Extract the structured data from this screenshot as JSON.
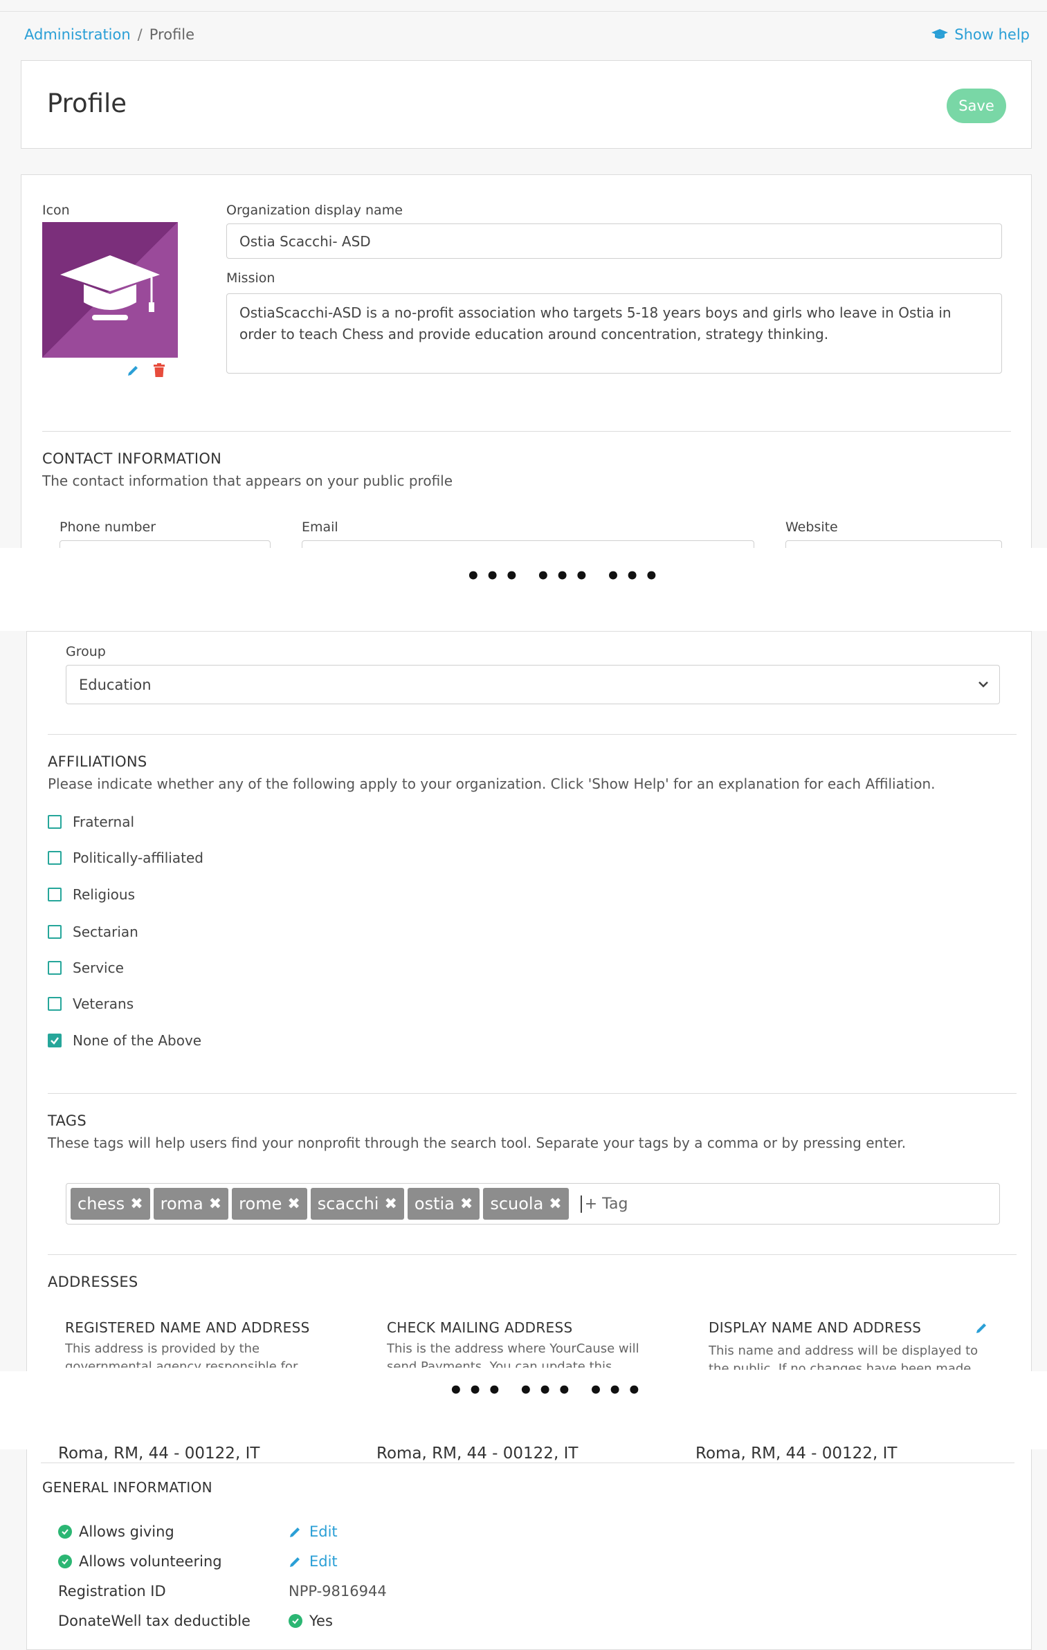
{
  "breadcrumb": {
    "root": "Administration",
    "separator": "/",
    "current": "Profile"
  },
  "help_label": "Show help",
  "header": {
    "title": "Profile",
    "save_label": "Save"
  },
  "profile": {
    "icon_label": "Icon",
    "display_name_label": "Organization display name",
    "display_name_value": "Ostia Scacchi- ASD",
    "mission_label": "Mission",
    "mission_value": "OstiaScacchi-ASD is a no-profit association who targets 5-18 years boys and girls who leave in Ostia in order to teach Chess and provide education around concentration, strategy thinking."
  },
  "contact": {
    "heading": "CONTACT INFORMATION",
    "description": "The contact information that appears on your public profile",
    "phone_label": "Phone number",
    "email_label": "Email",
    "website_label": "Website"
  },
  "truncation_marker": "••• ••• •••",
  "group": {
    "label": "Group",
    "selected": "Education"
  },
  "affiliations": {
    "heading": "AFFILIATIONS",
    "description": "Please indicate whether any of the following apply to your organization. Click 'Show Help' for an explanation for each Affiliation.",
    "options": [
      {
        "label": "Fraternal",
        "checked": false
      },
      {
        "label": "Politically-affiliated",
        "checked": false
      },
      {
        "label": "Religious",
        "checked": false
      },
      {
        "label": "Sectarian",
        "checked": false
      },
      {
        "label": "Service",
        "checked": false
      },
      {
        "label": "Veterans",
        "checked": false
      },
      {
        "label": "None of the Above",
        "checked": true
      }
    ]
  },
  "tags": {
    "heading": "TAGS",
    "description": "These tags will help users find your nonprofit through the search tool. Separate your tags by a comma or by pressing enter.",
    "items": [
      "chess",
      "roma",
      "rome",
      "scacchi",
      "ostia",
      "scuola"
    ],
    "placeholder": "+ Tag"
  },
  "addresses": {
    "heading": "ADDRESSES",
    "registered": {
      "title": "REGISTERED NAME AND ADDRESS",
      "desc": "This address is provided by the governmental agency responsible for registering your"
    },
    "mailing": {
      "title": "CHECK MAILING ADDRESS",
      "desc": "This is the address where YourCause will send Payments. You can update this address here:"
    },
    "display": {
      "title": "DISPLAY NAME AND ADDRESS",
      "desc": "This name and address will be displayed to the public. If no changes have been made to your"
    },
    "city_line": "Roma, RM, 44 - 00122, IT"
  },
  "general": {
    "heading": "GENERAL INFORMATION",
    "allows_giving": "Allows giving",
    "allows_volunteering": "Allows volunteering",
    "edit_label": "Edit",
    "registration_id_label": "Registration ID",
    "registration_id_value": "NPP-9816944",
    "tax_label": "DonateWell tax deductible",
    "tax_value": "Yes"
  },
  "colors": {
    "accent": "#2a9fd6",
    "save": "#79d7a6",
    "check": "#26a69a",
    "ok": "#2bb673",
    "danger": "#e74c3c",
    "tag": "#8d8d8d"
  }
}
